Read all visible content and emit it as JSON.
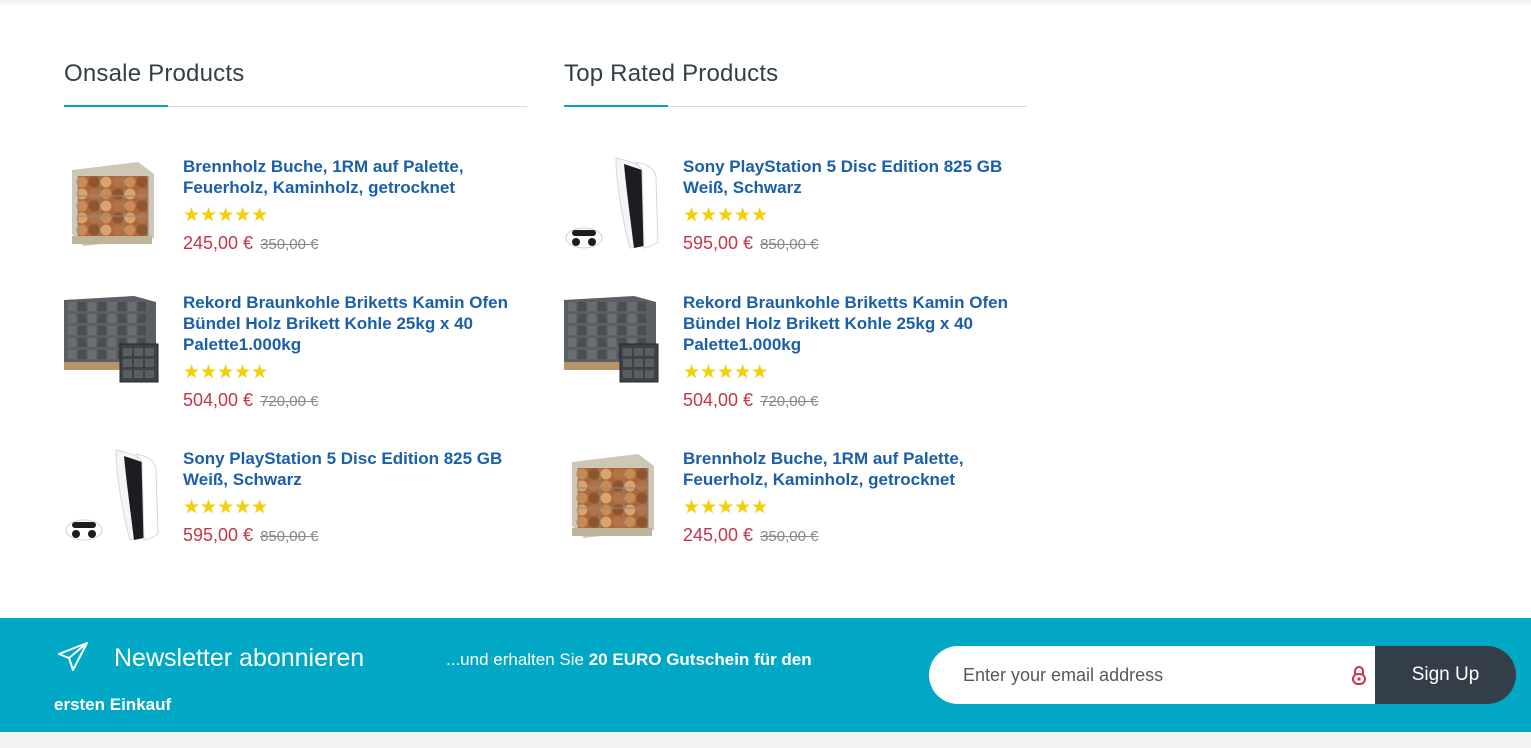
{
  "sections": {
    "onsale": {
      "title": "Onsale Products",
      "products": [
        {
          "name": "Brennholz Buche, 1RM auf Palette, Feuerholz, Kaminholz, getrocknet",
          "rating": 4.5,
          "price": "245,00 €",
          "old_price": "350,00 €",
          "image": "firewood-pallet"
        },
        {
          "name": "Rekord Braunkohle Briketts Kamin Ofen Bündel Holz Brikett Kohle 25kg x 40 Palette1.000kg",
          "rating": 4.75,
          "price": "504,00 €",
          "old_price": "720,00 €",
          "image": "briquette-pallet"
        },
        {
          "name": "Sony PlayStation 5 Disc Edition 825 GB Weiß, Schwarz",
          "rating": 5,
          "price": "595,00 €",
          "old_price": "850,00 €",
          "image": "ps5-console"
        }
      ]
    },
    "toprated": {
      "title": "Top Rated Products",
      "products": [
        {
          "name": "Sony PlayStation 5 Disc Edition 825 GB Weiß, Schwarz",
          "rating": 5,
          "price": "595,00 €",
          "old_price": "850,00 €",
          "image": "ps5-console"
        },
        {
          "name": "Rekord Braunkohle Briketts Kamin Ofen Bündel Holz Brikett Kohle 25kg x 40 Palette1.000kg",
          "rating": 4.75,
          "price": "504,00 €",
          "old_price": "720,00 €",
          "image": "briquette-pallet"
        },
        {
          "name": "Brennholz Buche, 1RM auf Palette, Feuerholz, Kaminholz, getrocknet",
          "rating": 4.5,
          "price": "245,00 €",
          "old_price": "350,00 €",
          "image": "firewood-pallet"
        }
      ]
    }
  },
  "newsletter": {
    "icon": "paper-plane-icon",
    "title": "Newsletter abonnieren",
    "text_prefix": "...und erhalten Sie ",
    "text_bold": "20 EURO Gutschein für den",
    "text_bold_2": "ersten Einkauf",
    "email_placeholder": "Enter your email address",
    "lock_icon": "lock-icon",
    "signup_label": "Sign Up"
  },
  "colors": {
    "accent": "#00a6c2",
    "newsletter_bg": "#00a8c6",
    "link": "#1a5fa8",
    "price": "#c4354a",
    "star": "#f5d000",
    "button_dark": "#333e48"
  }
}
